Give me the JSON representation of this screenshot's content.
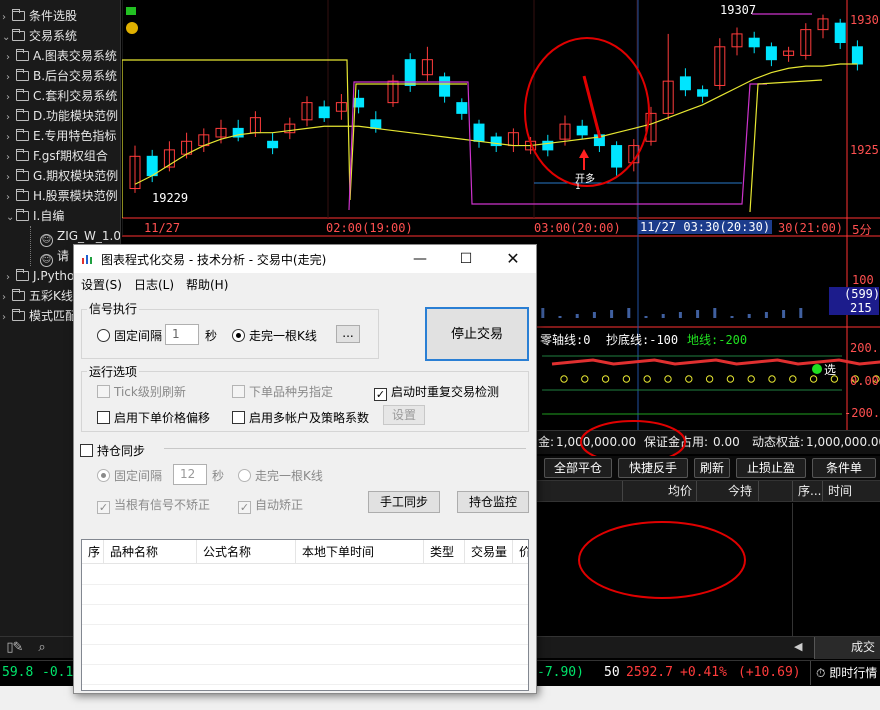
{
  "sidebar": {
    "items": [
      {
        "label": "条件选股",
        "level": 0,
        "kind": "folder"
      },
      {
        "label": "交易系统",
        "level": 0,
        "kind": "folder-open"
      },
      {
        "label": "A.图表交易系统",
        "level": 1,
        "kind": "folder"
      },
      {
        "label": "B.后台交易系统",
        "level": 1,
        "kind": "folder"
      },
      {
        "label": "C.套利交易系统",
        "level": 1,
        "kind": "folder"
      },
      {
        "label": "D.功能模块范例",
        "level": 1,
        "kind": "folder"
      },
      {
        "label": "E.专用特色指标",
        "level": 1,
        "kind": "folder"
      },
      {
        "label": "F.gsf期权组合",
        "level": 1,
        "kind": "folder"
      },
      {
        "label": "G.期权模块范例",
        "level": 1,
        "kind": "folder"
      },
      {
        "label": "H.股票模块范例",
        "level": 1,
        "kind": "folder"
      },
      {
        "label": "I.自编",
        "level": 1,
        "kind": "folder-open"
      },
      {
        "label": "ZIG_W_1.0",
        "level": 2,
        "kind": "formula"
      },
      {
        "label": "请",
        "level": 2,
        "kind": "formula"
      },
      {
        "label": "J.Python",
        "level": 1,
        "kind": "folder"
      },
      {
        "label": "五彩K线",
        "level": 0,
        "kind": "folder"
      },
      {
        "label": "模式匹配",
        "level": 0,
        "kind": "folder"
      }
    ]
  },
  "chart": {
    "price_labels": {
      "high": "19307",
      "low": "19229"
    },
    "y_ticks": [
      "1930",
      "1925"
    ],
    "x_ticks": [
      "11/27",
      "02:00(19:00)",
      "03:00(20:00)",
      "11/27 03:30(20:30)",
      "30(21:00)",
      "5分"
    ],
    "signal_label": "开多",
    "signal_count": "1",
    "indicator_values": [
      "100",
      "(599)",
      "215"
    ],
    "indicator_legend": {
      "zero_line": "零轴线:0",
      "bottom_line": "抄底线:-100",
      "floor_line": "地线:-200"
    },
    "indicator_ticks": [
      "200.",
      "0.00",
      "-200."
    ],
    "select_label": "选",
    "colors": {
      "up": "#ff3c3c",
      "down": "#00e5ff",
      "ma": "#e6e632",
      "zig": "#cc33cc",
      "axis": "#ff3232"
    }
  },
  "account": {
    "balance": "1,000,000.00",
    "balance_prefix": "金:",
    "margin_label": "保证金占用:",
    "margin_value": "0.00",
    "equity_label": "动态权益:",
    "equity_value": "1,000,000.00"
  },
  "actions": [
    "全部平仓",
    "快捷反手",
    "刷新",
    "止损止盈",
    "条件单"
  ],
  "grid_headers": [
    "均价",
    "今持",
    "序...",
    "时间"
  ],
  "deal_tab": "成交明",
  "status_bar": {
    "left_price": "59.8",
    "left_change": "-0.1",
    "mid_change": "-7.90)",
    "index_code": "50",
    "index_price": "2592.7",
    "index_pct": "+0.41%",
    "index_chg": "(+10.69)",
    "realtime_label": "即时行情"
  },
  "dialog": {
    "title": "图表程式化交易 - 技术分析 - 交易中(走完)",
    "menu": [
      "设置(S)",
      "日志(L)",
      "帮助(H)"
    ],
    "signal_group": {
      "label": "信号执行",
      "fixed_interval_label": "固定间隔",
      "fixed_interval_value": "1",
      "seconds_unit": "秒",
      "bar_complete_label": "走完一根K线",
      "more_button": "...",
      "selected": "bar_complete"
    },
    "stop_button": "停止交易",
    "run_group": {
      "label": "运行选项",
      "tick_refresh": "Tick级别刷新",
      "alt_symbol": "下单品种另指定",
      "restart_check": "启动时重复交易检测",
      "price_offset": "启用下单价格偏移",
      "multi_account": "启用多帐户及策略系数",
      "settings_button": "设置"
    },
    "sync_group": {
      "label": "持仓同步",
      "fixed_interval_label": "固定间隔",
      "fixed_interval_value": "12",
      "seconds_unit": "秒",
      "bar_complete_label": "走完一根K线",
      "no_correct": "当根有信号不矫正",
      "auto_correct": "自动矫正",
      "manual_sync": "手工同步",
      "monitor": "持仓监控"
    },
    "table_headers": [
      "序",
      "品种名称",
      "公式名称",
      "本地下单时间",
      "类型",
      "交易量",
      "价"
    ]
  }
}
